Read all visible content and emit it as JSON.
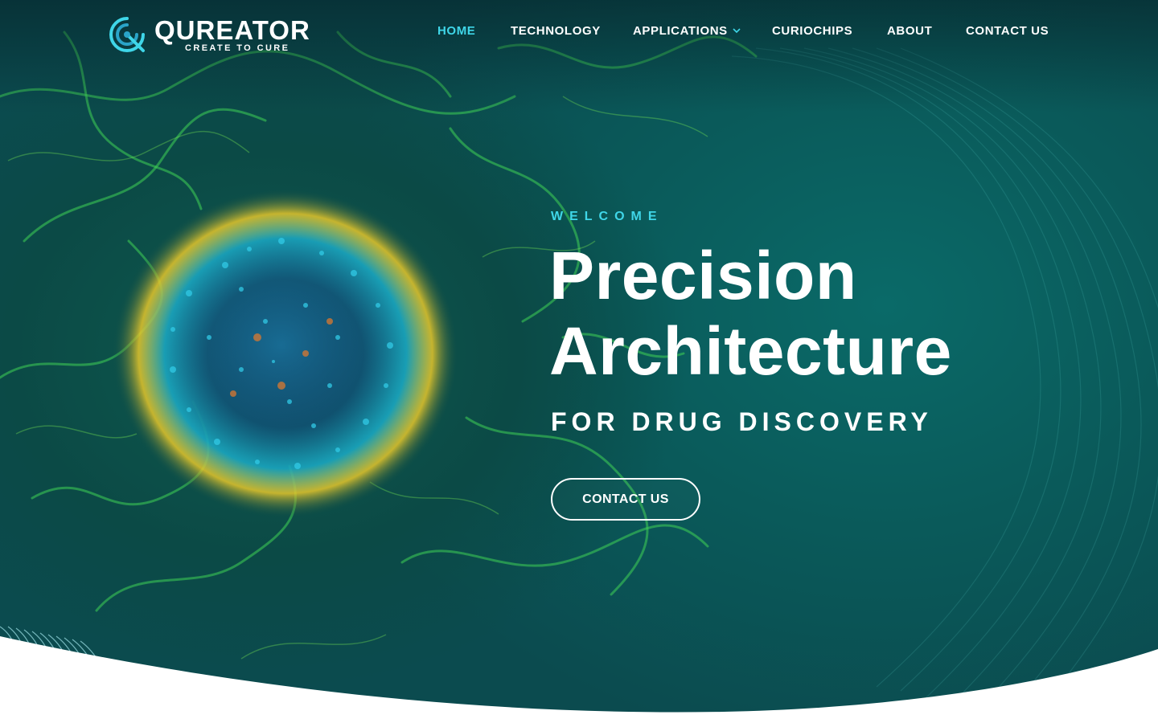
{
  "brand": {
    "name": "QUREATOR",
    "tagline": "CREATE TO CURE",
    "accent_color": "#3fd6e8",
    "logo_mark": "q-swirl-logo-icon"
  },
  "nav": {
    "items": [
      {
        "label": "HOME",
        "active": true
      },
      {
        "label": "TECHNOLOGY",
        "active": false
      },
      {
        "label": "APPLICATIONS",
        "active": false,
        "has_dropdown": true,
        "icon": "chevron-down-icon"
      },
      {
        "label": "CURIOCHIPS",
        "active": false
      },
      {
        "label": "ABOUT",
        "active": false
      },
      {
        "label": "CONTACT US",
        "active": false
      }
    ]
  },
  "hero": {
    "eyebrow": "WELCOME",
    "headline_line1": "Precision",
    "headline_line2": "Architecture",
    "subheadline": "FOR DRUG DISCOVERY",
    "cta_label": "CONTACT US",
    "background_image": "microscopy-organoid-image",
    "colors": {
      "background": "#0a5a5a",
      "text": "#ffffff",
      "eyebrow": "#3fd6e8"
    }
  }
}
